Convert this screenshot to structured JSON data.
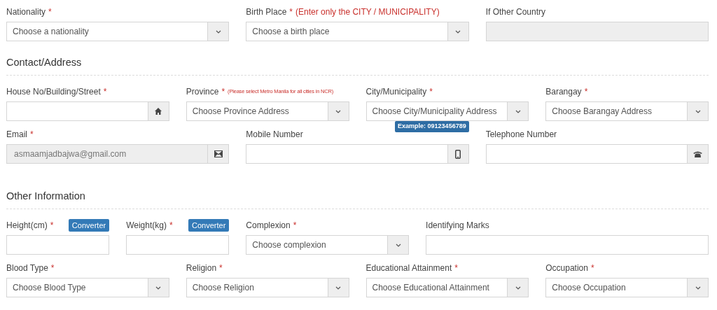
{
  "groups": [
    {
      "lines": [
        {
          "fields": [
            {
              "label": "Nationality",
              "mark": "*",
              "kind": "select",
              "placeholder": "Choose a nationality"
            },
            {
              "label": "Birth Place",
              "mark": "*",
              "note": "(Enter only the CITY / MUNICIPALITY)",
              "kind": "select",
              "placeholder": "Choose a birth place"
            },
            {
              "label": "If Other Country",
              "kind": "text",
              "disabled": true
            }
          ]
        }
      ]
    },
    {
      "heading": "Contact/Address",
      "lines": [
        {
          "fields": [
            {
              "label": "House No/Building/Street",
              "mark": "*",
              "kind": "address",
              "disabled": false
            },
            {
              "label": "Province",
              "mark": "*",
              "small_note": "(Please select Metro Manila for all cities in NCR)",
              "kind": "select",
              "placeholder": "Choose Province Address"
            },
            {
              "label": "City/Municipality",
              "mark": "*",
              "kind": "select",
              "placeholder": "Choose City/Municipality Address"
            },
            {
              "label": "Barangay",
              "mark": "*",
              "kind": "select",
              "placeholder": "Choose Barangay Address"
            }
          ]
        },
        {
          "fields": [
            {
              "label": "Email",
              "mark": "*",
              "kind": "email",
              "disabled": true,
              "value": "asmaamjadbajwa@gmail.com"
            },
            {
              "label": "Mobile Number",
              "badge": "Example: 09123456789",
              "kind": "mobile",
              "disabled": false
            },
            {
              "label": "Telephone Number",
              "kind": "telephone",
              "disabled": false
            }
          ]
        }
      ]
    },
    {
      "heading": "Other Information",
      "lines": [
        {
          "fields": [
            {
              "label": "Height(cm)",
              "mark": "*",
              "button": "Converter",
              "kind": "text",
              "disabled": false
            },
            {
              "label": "Weight(kg)",
              "mark": "*",
              "button": "Converter",
              "kind": "text",
              "disabled": false
            },
            {
              "label": "Complexion",
              "mark": "*",
              "kind": "select",
              "placeholder": "Choose complexion"
            },
            {
              "label": "Identifying Marks",
              "kind": "text",
              "disabled": false
            }
          ]
        },
        {
          "fields": [
            {
              "label": "Blood Type",
              "mark": "*",
              "kind": "select",
              "placeholder": "Choose Blood Type"
            },
            {
              "label": "Religion",
              "mark": "*",
              "kind": "select",
              "placeholder": "Choose Religion"
            },
            {
              "label": "Educational Attainment",
              "mark": "*",
              "kind": "select",
              "placeholder": "Choose Educational Attainment"
            },
            {
              "label": "Occupation",
              "mark": "*",
              "kind": "select",
              "placeholder": "Choose Occupation"
            }
          ]
        }
      ]
    }
  ]
}
